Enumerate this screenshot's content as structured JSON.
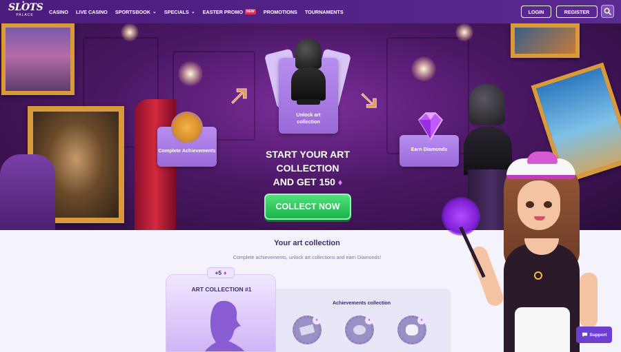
{
  "brand": {
    "logo_text": "SLOTS",
    "logo_sub": "PALACE"
  },
  "nav": {
    "items": [
      {
        "label": "CASINO",
        "dropdown": false
      },
      {
        "label": "LIVE CASINO",
        "dropdown": false
      },
      {
        "label": "SPORTSBOOK",
        "dropdown": true
      },
      {
        "label": "SPECIALS",
        "dropdown": true
      },
      {
        "label": "EASTER PROMO",
        "dropdown": false,
        "badge": "NEW"
      },
      {
        "label": "PROMOTIONS",
        "dropdown": false
      },
      {
        "label": "TOURNAMENTS",
        "dropdown": false
      }
    ],
    "login_label": "LOGIN",
    "register_label": "REGISTER",
    "search_icon": "search-icon"
  },
  "hero": {
    "card_unlock": "Unlock art collection",
    "card_achievements": "Complete Achievements",
    "card_diamonds": "Earn Diamonds",
    "headline_line1": "START YOUR ART",
    "headline_line2": "COLLECTION",
    "headline_line3": "AND GET 150",
    "collect_button": "COLLECT NOW"
  },
  "collection": {
    "title": "Your art collection",
    "subtitle": "Complete achievements, unlock art collections and earn Diamonds!",
    "reward_badge": "+5",
    "card_title": "ART COLLECTION #1",
    "achievements_title": "Achievements collection"
  },
  "support": {
    "label": "Support"
  },
  "colors": {
    "header_bg": "#4a1c7c",
    "cta_green": "#1cb34a",
    "accent_purple": "#a24ce6",
    "title_navy": "#3c2a70"
  }
}
